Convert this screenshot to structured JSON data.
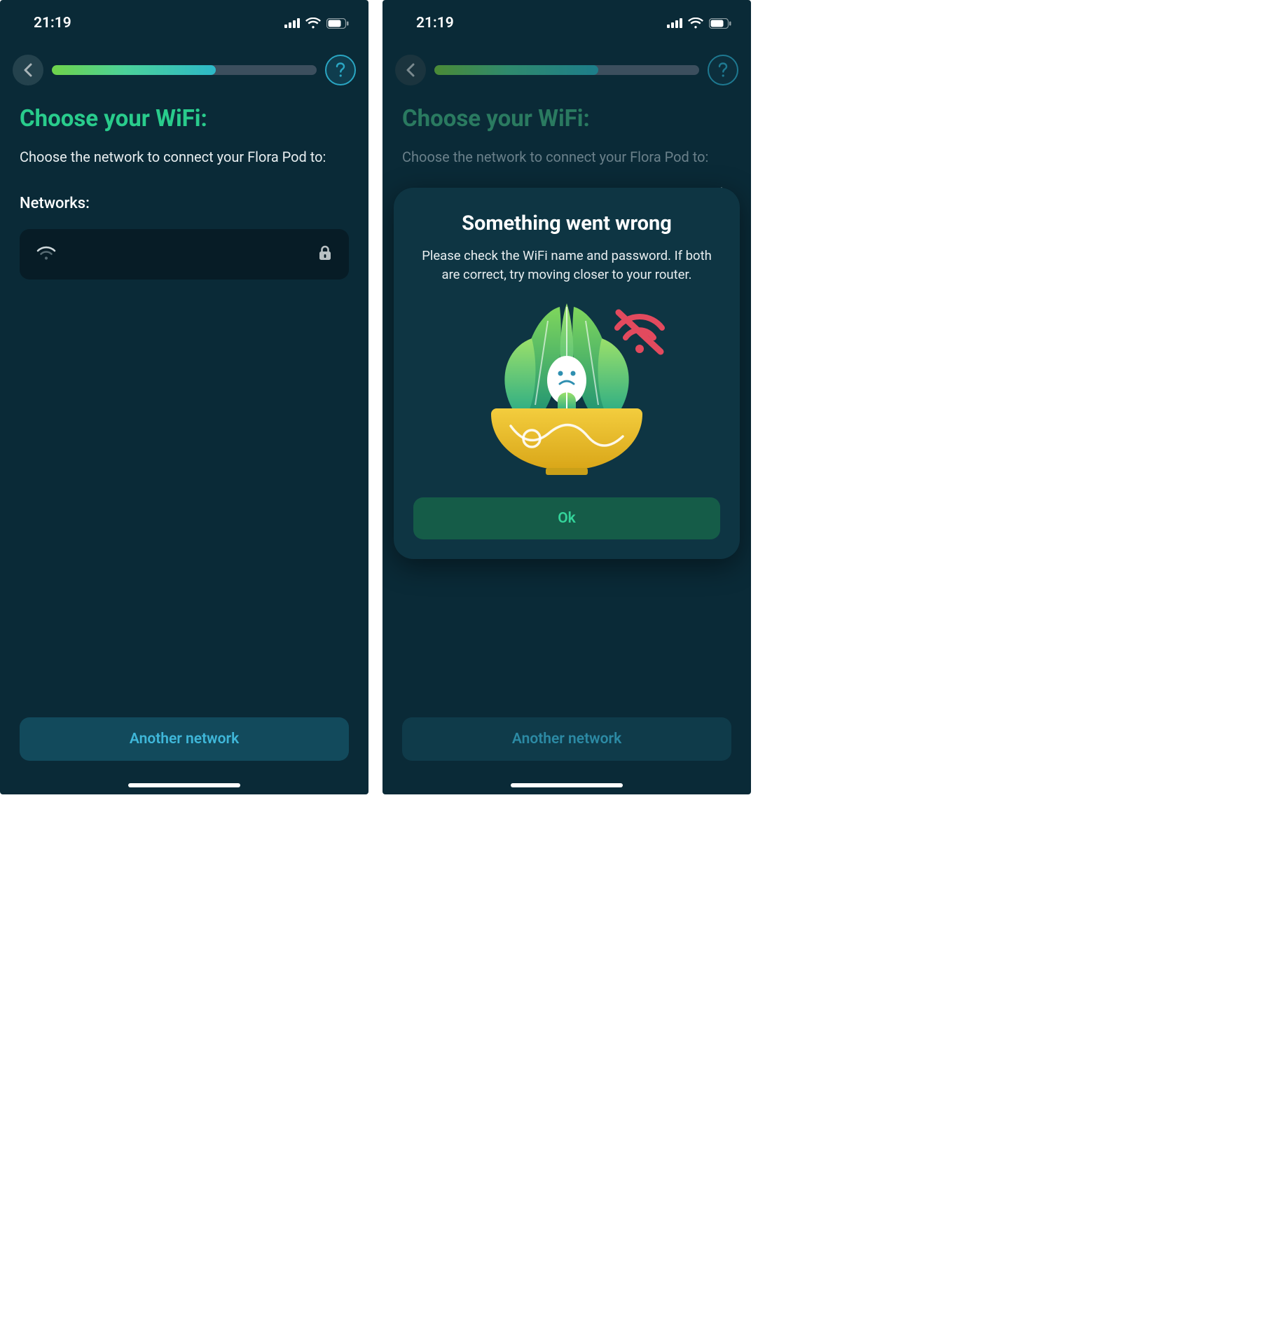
{
  "statusBar": {
    "time": "21:19"
  },
  "header": {
    "progressPercent": 62
  },
  "page": {
    "title": "Choose your WiFi:",
    "subtitle": "Choose the network to connect your Flora Pod to:",
    "networksLabel": "Networks:"
  },
  "networks": [
    {
      "name": "",
      "secured": true
    }
  ],
  "bottomButton": {
    "label": "Another network"
  },
  "modal": {
    "title": "Something went wrong",
    "body": "Please check the WiFi name and password. If both are correct, try moving closer to your router.",
    "okLabel": "Ok"
  }
}
